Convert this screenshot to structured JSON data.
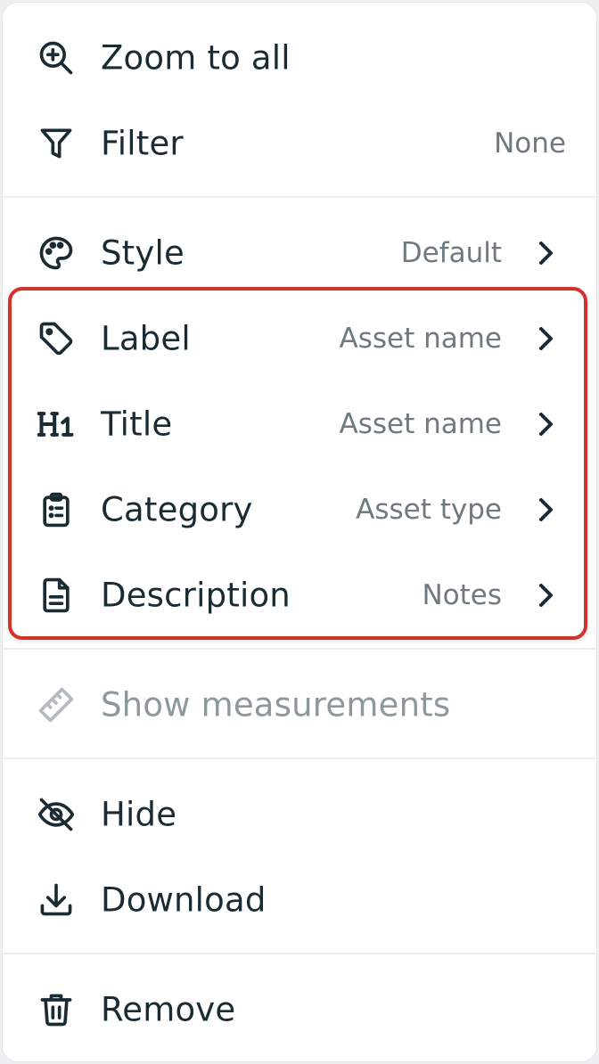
{
  "menu": {
    "zoom": {
      "label": "Zoom to all",
      "icon": "zoom-in-icon"
    },
    "filter": {
      "label": "Filter",
      "value": "None",
      "icon": "filter-icon"
    },
    "style": {
      "label": "Style",
      "value": "Default",
      "icon": "palette-icon"
    },
    "label": {
      "label": "Label",
      "value": "Asset name",
      "icon": "tag-icon"
    },
    "title": {
      "label": "Title",
      "value": "Asset name",
      "icon": "heading-h1-icon"
    },
    "category": {
      "label": "Category",
      "value": "Asset type",
      "icon": "clipboard-list-icon"
    },
    "description": {
      "label": "Description",
      "value": "Notes",
      "icon": "document-icon"
    },
    "measurements": {
      "label": "Show measurements",
      "icon": "ruler-icon",
      "disabled": true
    },
    "hide": {
      "label": "Hide",
      "icon": "eye-off-icon"
    },
    "download": {
      "label": "Download",
      "icon": "download-icon"
    },
    "remove": {
      "label": "Remove",
      "icon": "trash-icon"
    }
  },
  "colors": {
    "text": "#1b2b33",
    "muted": "#6e7a80",
    "disabled": "#8d989d",
    "highlight": "#d4332c"
  }
}
